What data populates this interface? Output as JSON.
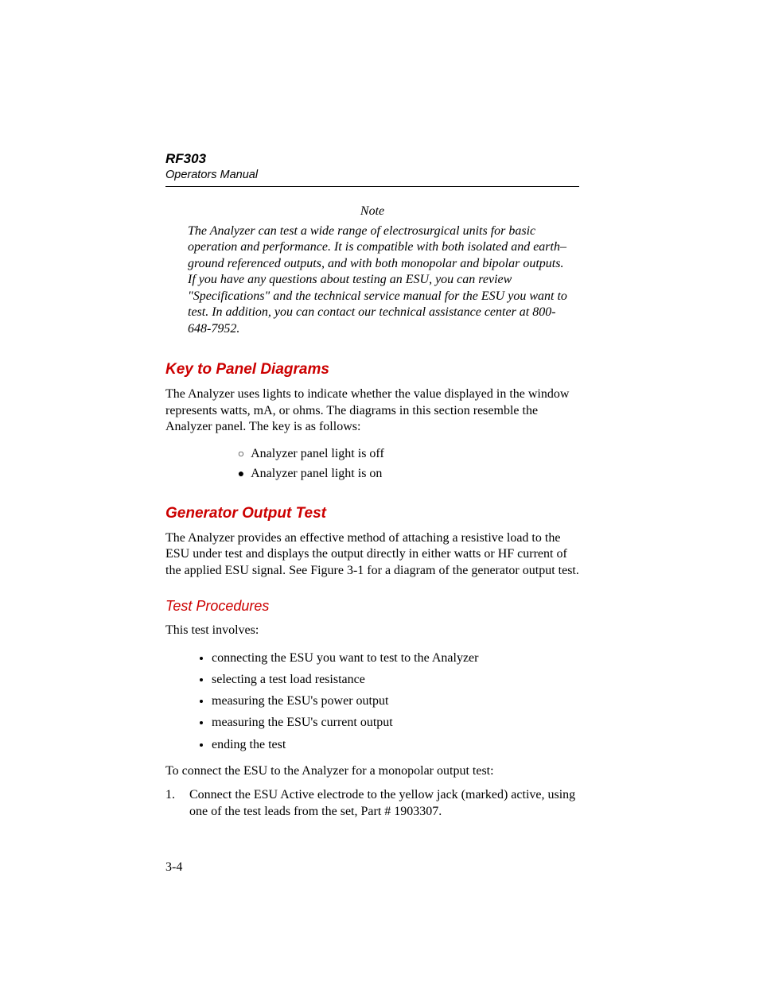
{
  "header": {
    "title": "RF303",
    "subtitle": "Operators Manual"
  },
  "note": {
    "label": "Note",
    "body": "The Analyzer can test a wide range of electrosurgical units for basic operation and performance. It is compatible with both isolated and earth–ground referenced outputs, and with both monopolar and bipolar outputs. If you have any questions about  testing an ESU, you can review \"Specifications\" and the technical service manual for the ESU you want to test. In addition, you can contact our technical assistance center at 800-648-7952."
  },
  "sections": {
    "key_panel": {
      "heading": "Key to Panel Diagrams",
      "body": "The Analyzer uses lights to indicate whether the value displayed in the window represents watts, mA, or ohms. The diagrams in this section resemble the Analyzer panel. The key is as follows:",
      "items": [
        {
          "symbol": "off",
          "text": "Analyzer panel light is off"
        },
        {
          "symbol": "on",
          "text": "Analyzer panel light is on"
        }
      ]
    },
    "gen_output": {
      "heading": "Generator Output Test",
      "body": "The Analyzer provides an effective method of attaching a resistive load to the ESU under test and displays the output directly in either watts or HF current of the applied ESU signal. See Figure 3-1 for a diagram of the generator output test."
    },
    "test_proc": {
      "heading": "Test Procedures",
      "intro": "This test involves:",
      "bullets": [
        "connecting the ESU you want to test to the Analyzer",
        "selecting a test load resistance",
        "measuring the ESU's power output",
        "measuring the ESU's current output",
        "ending the test"
      ],
      "connect_intro": "To connect the ESU to the Analyzer for a monopolar output test:",
      "steps": [
        "Connect the ESU Active electrode to the yellow jack (marked) active, using one of the test leads from the set, Part # 1903307."
      ]
    }
  },
  "symbols": {
    "off": "○",
    "on": "●"
  },
  "page_number": "3-4"
}
